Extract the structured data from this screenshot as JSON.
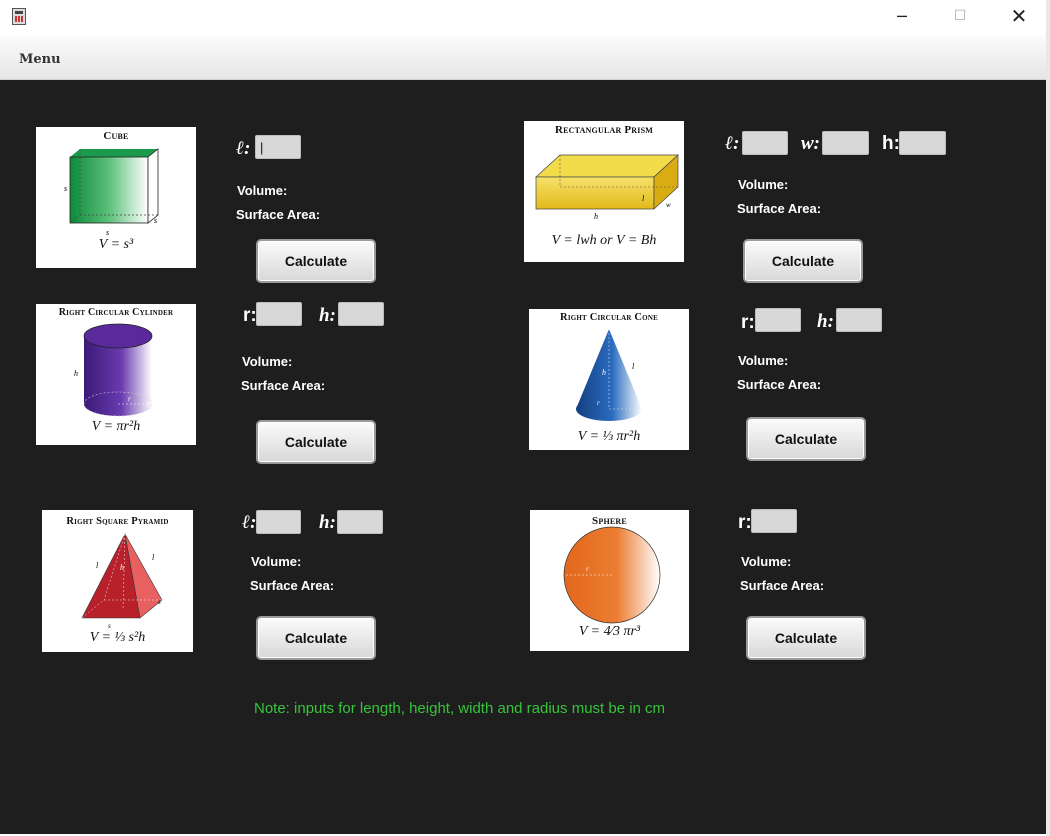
{
  "window": {
    "minimize_glyph": "─",
    "maximize_glyph": "☐",
    "close_glyph": "✕"
  },
  "menubar": {
    "menu_label": "Menu"
  },
  "cube": {
    "title": "Cube",
    "formula": "V = s³",
    "var_l": "ℓ:",
    "input_l": "|",
    "volume_label": "Volume:",
    "surface_label": "Surface Area:",
    "button": "Calculate"
  },
  "prism": {
    "title": "Rectangular Prism",
    "formula": "V = lwh or V = Bh",
    "var_l": "ℓ:",
    "var_w": "w:",
    "var_h": "h:",
    "volume_label": "Volume:",
    "surface_label": "Surface Area:",
    "button": "Calculate"
  },
  "cylinder": {
    "title": "Right Circular Cylinder",
    "formula": "V = πr²h",
    "var_r": "r:",
    "var_h": "h:",
    "volume_label": "Volume:",
    "surface_label": "Surface Area:",
    "button": "Calculate"
  },
  "cone": {
    "title": "Right Circular Cone",
    "formula": "V = ⅓ πr²h",
    "var_r": "r:",
    "var_h": "h:",
    "volume_label": "Volume:",
    "surface_label": "Surface Area:",
    "button": "Calculate"
  },
  "pyramid": {
    "title": "Right Square Pyramid",
    "formula": "V = ⅓ s²h",
    "var_l": "ℓ:",
    "var_h": "h:",
    "volume_label": "Volume:",
    "surface_label": "Surface Area:",
    "button": "Calculate"
  },
  "sphere": {
    "title": "Sphere",
    "formula": "V = 4⁄3 πr³",
    "var_r": "r:",
    "volume_label": "Volume:",
    "surface_label": "Surface Area:",
    "button": "Calculate"
  },
  "note": "Note: inputs for length, height, width and radius must be in cm",
  "colors": {
    "background": "#1e1e1e",
    "note_text": "#35c53a",
    "cube": "#1a9a4a",
    "prism": "#e9c92a",
    "cylinder": "#4a2a8c",
    "cone": "#1f5aa8",
    "pyramid": "#b8202a",
    "sphere": "#e8732a"
  }
}
